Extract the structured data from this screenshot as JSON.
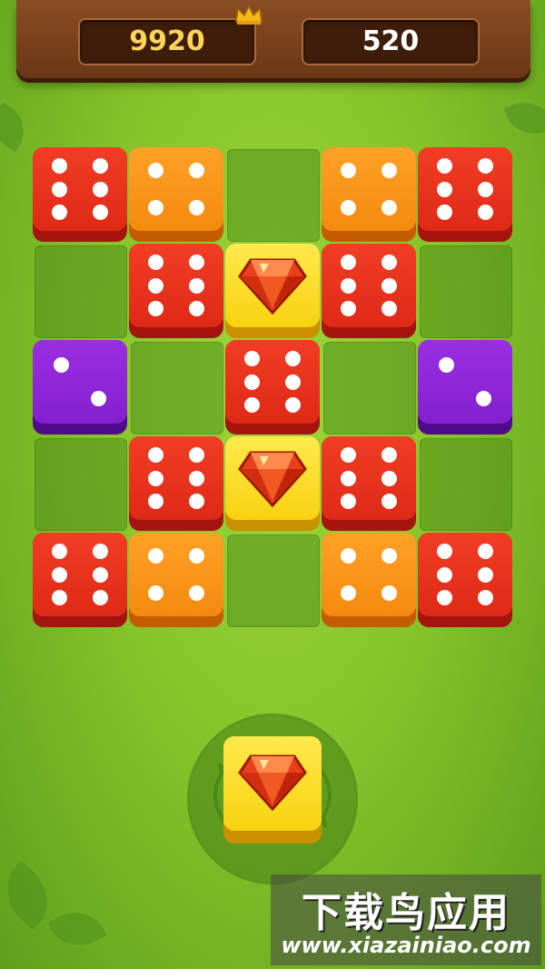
{
  "header": {
    "best_score": "9920",
    "current_score": "520",
    "best_icon": "crown-icon"
  },
  "board": {
    "columns": 5,
    "rows": 5,
    "cells": [
      [
        "die-red-6",
        "die-orange-4",
        "empty",
        "die-orange-4",
        "die-red-6"
      ],
      [
        "empty",
        "die-red-6",
        "gem",
        "die-red-6",
        "empty"
      ],
      [
        "die-purple-2",
        "empty",
        "die-red-6",
        "empty",
        "die-purple-2"
      ],
      [
        "empty",
        "die-red-6",
        "gem",
        "die-red-6",
        "empty"
      ],
      [
        "die-red-6",
        "die-orange-4",
        "empty",
        "die-orange-4",
        "die-red-6"
      ]
    ]
  },
  "next_piece": {
    "type": "gem",
    "rotate_icon": "rotate-arrows-icon"
  },
  "watermark": {
    "title": "下载鸟应用",
    "url": "www.xiazainiao.com"
  },
  "colors": {
    "red": "#e8301b",
    "orange": "#f7921a",
    "purple": "#8b24d6",
    "yellow": "#f9da20",
    "board_green": "#86c52a",
    "wood": "#7a411b"
  }
}
